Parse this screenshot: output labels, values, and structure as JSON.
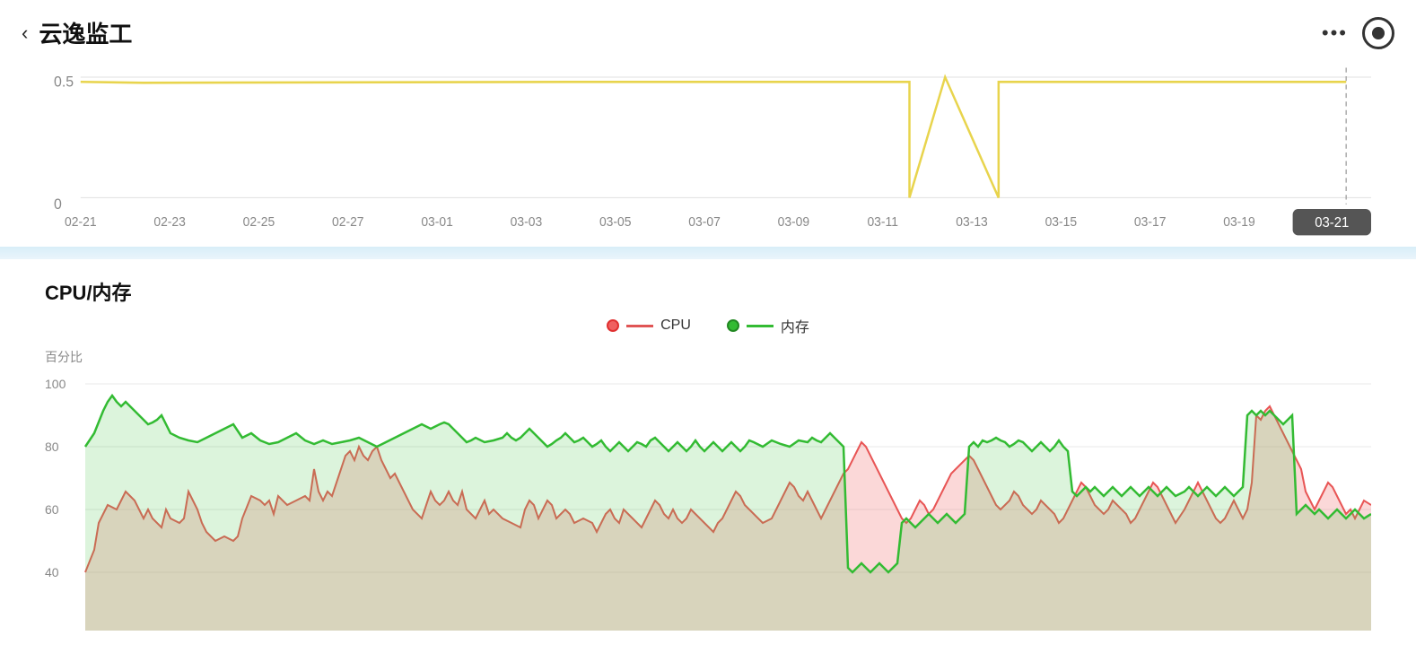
{
  "header": {
    "title": "云逸监工",
    "back_label": "‹",
    "more_label": "•••"
  },
  "top_chart": {
    "y_labels": [
      "0.5",
      "0"
    ],
    "x_labels": [
      "02-21",
      "02-23",
      "02-25",
      "02-27",
      "03-01",
      "03-03",
      "03-05",
      "03-07",
      "03-09",
      "03-11",
      "03-13",
      "03-15",
      "03-17",
      "03-19",
      "03-21"
    ],
    "current_date": "03-21"
  },
  "cpu_section": {
    "title": "CPU/内存",
    "y_axis_label": "百分比",
    "y_labels": [
      "100",
      "80",
      "60",
      "40"
    ],
    "legend": {
      "cpu_label": "CPU",
      "mem_label": "内存"
    }
  }
}
